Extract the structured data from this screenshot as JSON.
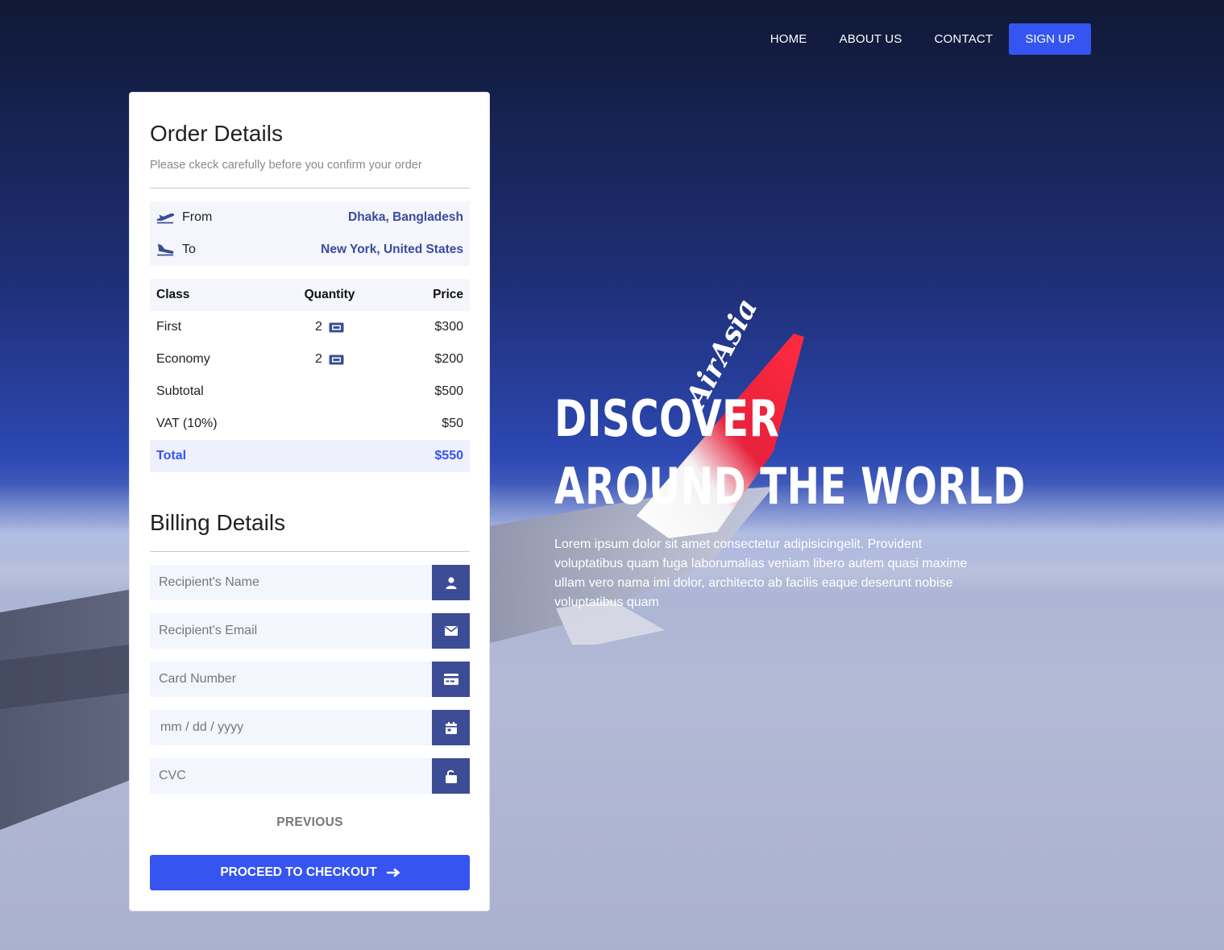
{
  "nav": {
    "links": [
      "HOME",
      "ABOUT US",
      "CONTACT"
    ],
    "signup": "SIGN UP"
  },
  "order": {
    "title": "Order Details",
    "subtitle": "Please ckeck carefully before you confirm your order",
    "from_label": "From",
    "from_value": "Dhaka, Bangladesh",
    "to_label": "To",
    "to_value": "New York, United States",
    "table": {
      "headers": [
        "Class",
        "Quantity",
        "Price"
      ],
      "rows": [
        {
          "class": "First",
          "qty": "2",
          "price": "$300"
        },
        {
          "class": "Economy",
          "qty": "2",
          "price": "$200"
        }
      ],
      "subtotal_label": "Subtotal",
      "subtotal_value": "$500",
      "vat_label": "VAT (10%)",
      "vat_value": "$50",
      "total_label": "Total",
      "total_value": "$550"
    }
  },
  "billing": {
    "title": "Billing Details",
    "name_placeholder": "Recipient's Name",
    "email_placeholder": "Recipient's Email",
    "card_placeholder": "Card Number",
    "date_placeholder": "mm / dd / yyyy",
    "cvc_placeholder": "CVC",
    "previous": "PREVIOUS",
    "checkout": "PROCEED TO CHECKOUT"
  },
  "hero": {
    "line1": "DISCOVER",
    "line2": "AROUND THE WORLD",
    "text": "Lorem ipsum dolor sit amet consectetur adipisicingelit. Provident voluptatibus quam fuga laborumalias veniam libero autem quasi maxime ullam vero nama imi dolor, architecto ab facilis eaque deserunt nobise voluptatibus quam",
    "wing_text": "AirAsia"
  },
  "colors": {
    "accent": "#3554f0",
    "addon": "#3d4d95",
    "route_value": "#3b4a9e"
  }
}
